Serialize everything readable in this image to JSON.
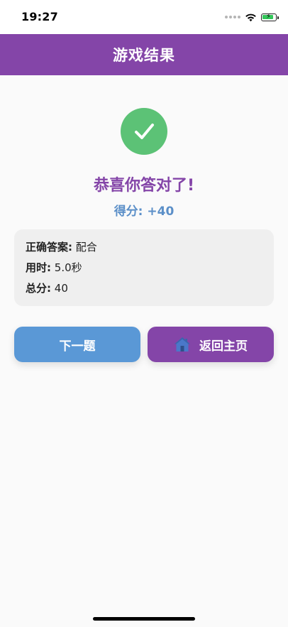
{
  "status_bar": {
    "time": "19:27",
    "icons": [
      "cellular-dots-icon",
      "wifi-icon",
      "battery-charging-icon"
    ],
    "battery_level": 0.75
  },
  "nav": {
    "title": "游戏结果"
  },
  "result": {
    "icon": "checkmark-icon",
    "title": "恭喜你答对了!",
    "score_text": "得分: +40"
  },
  "details": {
    "answer_label": "正确答案:",
    "answer_value": "配合",
    "time_label": "用时:",
    "time_value": "5.0秒",
    "total_label": "总分:",
    "total_value": "40"
  },
  "buttons": {
    "next_label": "下一题",
    "home_label": "返回主页",
    "home_icon": "house-icon"
  },
  "colors": {
    "primary": "#8445a8",
    "success": "#5cc276",
    "accent_blue": "#5a98d6",
    "score_blue": "#5b8fc8",
    "card_bg": "#efefef"
  }
}
